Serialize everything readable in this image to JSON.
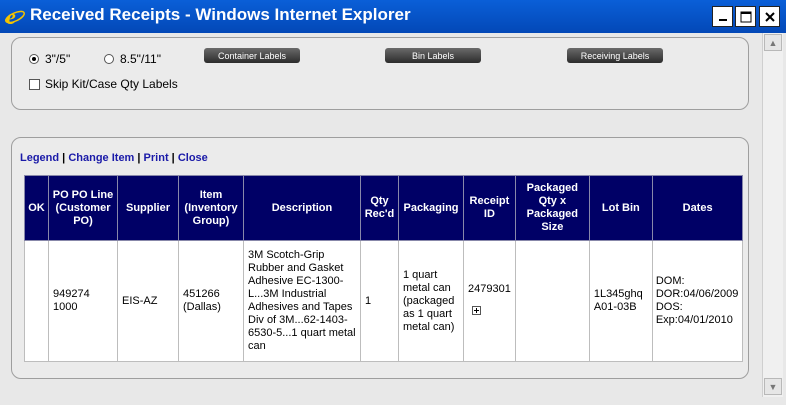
{
  "window": {
    "title": "Received Receipts - Windows Internet Explorer"
  },
  "options": {
    "size_3x5": "3\"/5\"",
    "size_85x11": "8.5\"/11\"",
    "selected": "3\"/5\"",
    "skip_kit_label": "Skip Kit/Case Qty Labels",
    "skip_kit_checked": false
  },
  "buttons": {
    "container_labels": "Container Labels",
    "bin_labels": "Bin Labels",
    "receiving_labels": "Receiving Labels"
  },
  "links": {
    "legend": "Legend",
    "change_item": "Change Item",
    "print": "Print",
    "close": "Close",
    "separator": " | "
  },
  "table": {
    "headers": {
      "ok": "OK",
      "po": "PO PO Line (Customer PO)",
      "supplier": "Supplier",
      "item": "Item (Inventory Group)",
      "description": "Description",
      "qty": "Qty Rec'd",
      "packaging": "Packaging",
      "receipt": "Receipt ID",
      "packaged_qty": "Packaged Qty x Packaged Size",
      "lot_bin": "Lot Bin",
      "dates": "Dates"
    },
    "rows": [
      {
        "ok": "",
        "po": "949274",
        "po_line": "1000",
        "supplier": "EIS-AZ",
        "item": "451266",
        "item_group": "(Dallas)",
        "description": "3M Scotch-Grip Rubber and Gasket Adhesive EC-1300-L...3M Industrial Adhesives and Tapes Div of 3M...62-1403-6530-5...1 quart metal can",
        "qty": "1",
        "packaging": "1 quart metal can (packaged as 1 quart metal can)",
        "receipt_id": "2479301",
        "packaged_qty": "",
        "lot": "1L345ghq",
        "bin": "A01-03B",
        "dom": "DOM:",
        "dor": "DOR:04/06/2009",
        "dos": "DOS:",
        "exp": "Exp:04/01/2010"
      }
    ]
  }
}
